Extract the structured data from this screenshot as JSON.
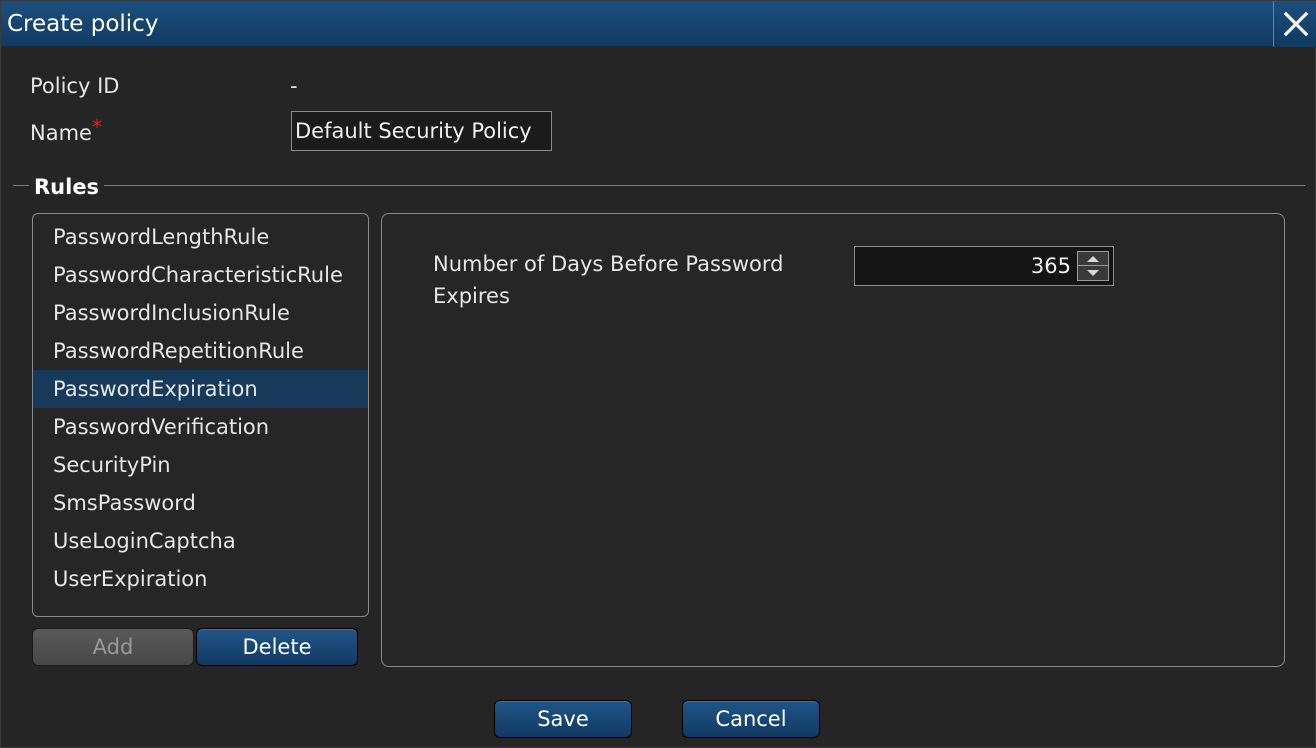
{
  "window": {
    "title": "Create policy"
  },
  "form": {
    "policy_id_label": "Policy ID",
    "policy_id_value": "-",
    "name_label": "Name",
    "required_mark": "*",
    "name_value": "Default Security Policy"
  },
  "rules": {
    "legend": "Rules",
    "items": [
      {
        "label": "PasswordLengthRule"
      },
      {
        "label": "PasswordCharacteristicRule"
      },
      {
        "label": "PasswordInclusionRule"
      },
      {
        "label": "PasswordRepetitionRule"
      },
      {
        "label": "PasswordExpiration"
      },
      {
        "label": "PasswordVerification"
      },
      {
        "label": "SecurityPin"
      },
      {
        "label": "SmsPassword"
      },
      {
        "label": "UseLoginCaptcha"
      },
      {
        "label": "UserExpiration"
      }
    ],
    "selected_index": 4,
    "add_label": "Add",
    "delete_label": "Delete"
  },
  "detail": {
    "days_label": "Number of Days Before Password Expires",
    "days_value": "365"
  },
  "footer": {
    "save_label": "Save",
    "cancel_label": "Cancel"
  },
  "colors": {
    "accent": "#173a5b",
    "titlebar": "#123a60",
    "required": "#e02020"
  },
  "icons": {
    "close": "close-icon",
    "spin_up": "arrow-up-icon",
    "spin_down": "arrow-down-icon"
  }
}
